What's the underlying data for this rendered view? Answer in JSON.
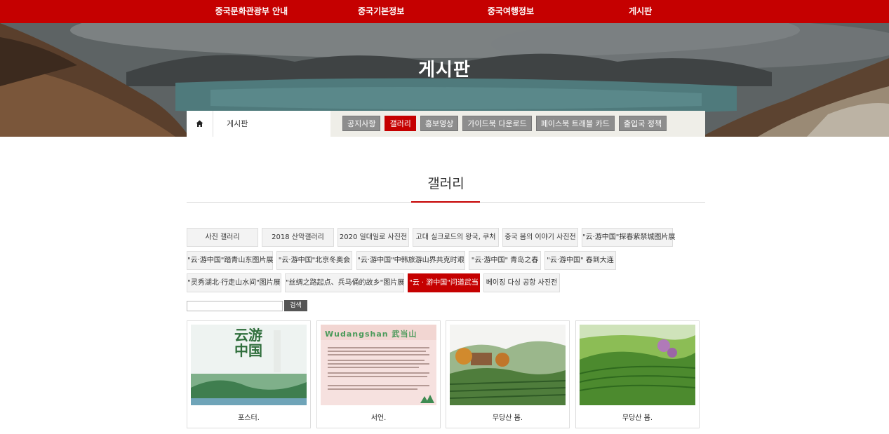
{
  "topnav": {
    "items": [
      "중국문화관광부 안내",
      "중국기본정보",
      "중국여행정보",
      "게시판"
    ]
  },
  "hero": {
    "title": "게시판"
  },
  "breadcrumb": {
    "current": "게시판"
  },
  "tabs": [
    {
      "label": "공지사항",
      "active": false
    },
    {
      "label": "갤러리",
      "active": true
    },
    {
      "label": "홍보영상",
      "active": false
    },
    {
      "label": "가이드북 다운로드",
      "active": false
    },
    {
      "label": "페이스북 트래블 카드",
      "active": false
    },
    {
      "label": "출입국 정책",
      "active": false
    }
  ],
  "section": {
    "title": "갤러리"
  },
  "categories": [
    {
      "label": "사진 갤러리",
      "active": false
    },
    {
      "label": "2018 산악갤러리",
      "active": false
    },
    {
      "label": "2020 일대일로 사진전",
      "active": false
    },
    {
      "label": "고대 실크로드의 왕국, 쿠처",
      "active": false
    },
    {
      "label": "중국 봄의 이야기 사진전",
      "active": false
    },
    {
      "label": "\"云·游中国\"探春紫禁城图片展",
      "active": false
    },
    {
      "label": "\"云·游中国\"踏青山东图片展",
      "active": false
    },
    {
      "label": "\"云·游中国\"北京冬奥会",
      "active": false
    },
    {
      "label": "\"云·游中国\"中韩旅游山界共克时艰",
      "active": false
    },
    {
      "label": "\"云·游中国\" 青岛之春",
      "active": false
    },
    {
      "label": "\"云·游中国\" 春到大连",
      "active": false
    },
    {
      "label": "\"灵秀湖北·行走山水间\"图片展",
      "active": false
    },
    {
      "label": "\"丝绸之路起点、兵马俑的故乡\"图片展",
      "active": false
    },
    {
      "label": "\"云 · 游中国\"问道武当",
      "active": true
    },
    {
      "label": "베이징 다싱 공항 사진전",
      "active": false
    }
  ],
  "search": {
    "placeholder": "",
    "button": "검색"
  },
  "gallery": [
    {
      "caption": "포스터.",
      "thumb_text": "云游中国"
    },
    {
      "caption": "서언.",
      "thumb_text": "Wudangshan 武当山"
    },
    {
      "caption": "무당산 봄.",
      "thumb_text": ""
    },
    {
      "caption": "무당산 봄.",
      "thumb_text": ""
    }
  ],
  "colors": {
    "accent": "#c50000",
    "tab_inactive": "#8d8d8d",
    "subbar_bg": "#efeee8"
  },
  "icons": {
    "home": "home-icon"
  }
}
